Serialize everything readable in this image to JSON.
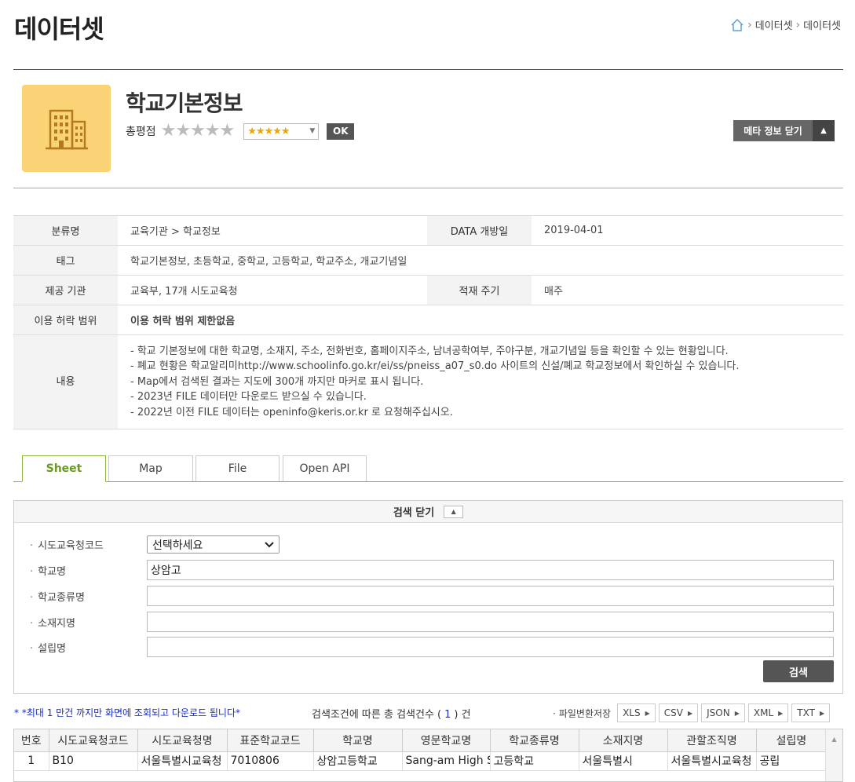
{
  "header": {
    "title": "데이터셋",
    "breadcrumb": [
      "데이터셋",
      "데이터셋"
    ]
  },
  "dataset": {
    "name": "학교기본정보",
    "rating_label": "총평점",
    "rating_stars": "★★★★★",
    "rating_select": "★★★★★",
    "ok_label": "OK",
    "meta_toggle_label": "메타 정보 닫기",
    "icon_color": "#f9d376"
  },
  "meta": {
    "category_label": "분류명",
    "category_value": "교육기관 > 학교정보",
    "open_date_label": "DATA 개방일",
    "open_date_value": "2019-04-01",
    "tag_label": "태그",
    "tag_value": "학교기본정보, 초등학교, 중학교, 고등학교, 학교주소, 개교기념일",
    "provider_label": "제공 기관",
    "provider_value": "교육부, 17개 시도교육청",
    "cycle_label": "적재 주기",
    "cycle_value": "매주",
    "license_label": "이용 허락 범위",
    "license_value": "이용 허락 범위 제한없음",
    "content_label": "내용",
    "content_lines": [
      "- 학교 기본정보에 대한 학교명, 소재지, 주소, 전화번호, 홈페이지주소, 남녀공학여부, 주야구분, 개교기념일 등을 확인할 수 있는 현황입니다.",
      "- 폐교 현황은 학교알리미http://www.schoolinfo.go.kr/ei/ss/pneiss_a07_s0.do 사이트의 신설/폐교 학교정보에서 확인하실 수 있습니다.",
      "- Map에서 검색된 결과는 지도에 300개 까지만 마커로 표시 됩니다.",
      "- 2023년 FILE 데이터만 다운로드 받으실 수 있습니다.",
      "- 2022년 이전 FILE 데이터는 openinfo@keris.or.kr 로 요청해주십시오."
    ]
  },
  "tabs": [
    "Sheet",
    "Map",
    "File",
    "Open API"
  ],
  "search": {
    "header_label": "검색 닫기",
    "fields": [
      {
        "label": "시도교육청코드",
        "value": "선택하세요"
      },
      {
        "label": "학교명",
        "value": "상암고"
      },
      {
        "label": "학교종류명",
        "value": ""
      },
      {
        "label": "소재지명",
        "value": ""
      },
      {
        "label": "설립명",
        "value": ""
      }
    ],
    "button_label": "검색"
  },
  "results": {
    "notice": "* *최대 1 만건 까지만 화면에 조회되고 다운로드 됩니다*",
    "count_prefix": "검색조건에 따른 총 검색건수 (",
    "count": "1",
    "count_suffix": ") 건",
    "export_label": "파일변환저장",
    "formats": [
      "XLS",
      "CSV",
      "JSON",
      "XML",
      "TXT"
    ]
  },
  "grid": {
    "columns": [
      "번호",
      "시도교육청코드",
      "시도교육청명",
      "표준학교코드",
      "학교명",
      "영문학교명",
      "학교종류명",
      "소재지명",
      "관할조직명",
      "설립명"
    ],
    "rows": [
      [
        "1",
        "B10",
        "서울특별시교육청",
        "7010806",
        "상암고등학교",
        "Sang-am High School",
        "고등학교",
        "서울특별시",
        "서울특별시교육청",
        "공립"
      ]
    ]
  },
  "colors": {
    "accent_green": "#8ab43a",
    "notice_blue": "#1a2fbf",
    "star_gold": "#f0a500"
  }
}
